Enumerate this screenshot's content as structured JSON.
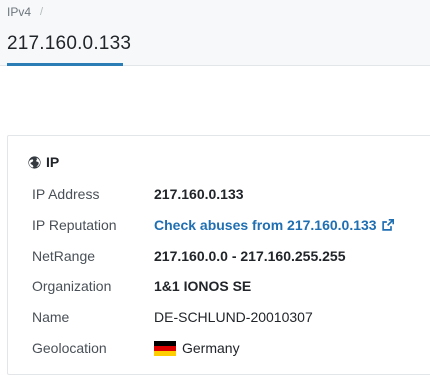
{
  "breadcrumb": {
    "items": [
      "IPv4"
    ],
    "separator": "/"
  },
  "page": {
    "title": "217.160.0.133"
  },
  "card": {
    "title": "IP",
    "rows": [
      {
        "label": "IP Address",
        "value": "217.160.0.133"
      },
      {
        "label": "IP Reputation",
        "value": "Check abuses from 217.160.0.133"
      },
      {
        "label": "NetRange",
        "value": "217.160.0.0 - 217.160.255.255"
      },
      {
        "label": "Organization",
        "value": "1&1 IONOS SE"
      },
      {
        "label": "Name",
        "value": "DE-SCHLUND-20010307"
      },
      {
        "label": "Geolocation",
        "value": "Germany"
      }
    ]
  },
  "colors": {
    "accent": "#2a7db5",
    "link": "#1f6fb2",
    "header_bg": "#f7f8f9"
  },
  "icons": {
    "card_title": "globe-icon",
    "reputation_link": "external-link-icon",
    "geolocation": "germany-flag-icon"
  }
}
